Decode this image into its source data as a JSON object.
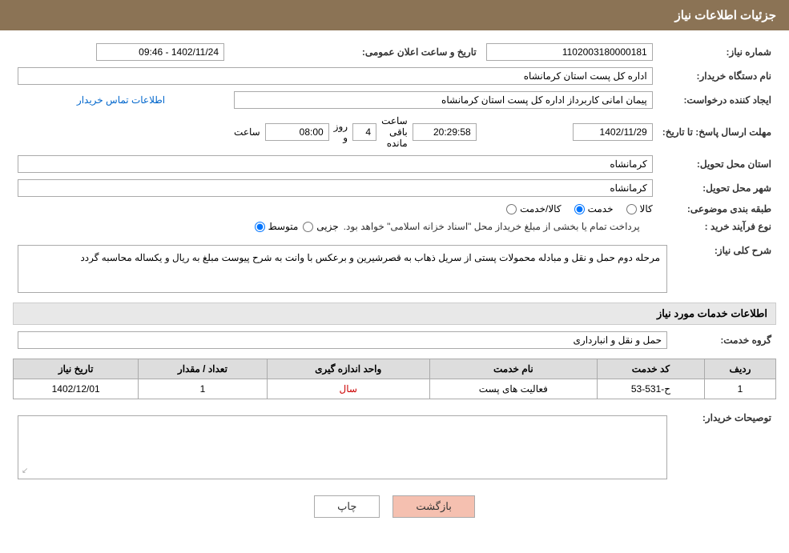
{
  "header": {
    "title": "جزئیات اطلاعات نیاز"
  },
  "fields": {
    "order_number_label": "شماره نیاز:",
    "order_number_value": "1102003180000181",
    "buyer_org_label": "نام دستگاه خریدار:",
    "buyer_org_value": "اداره کل پست استان کرمانشاه",
    "public_announce_label": "تاریخ و ساعت اعلان عمومی:",
    "public_announce_value": "1402/11/24 - 09:46",
    "creator_label": "ایجاد کننده درخواست:",
    "creator_value": "پیمان امانی کاربرداز اداره کل پست استان کرمانشاه",
    "contact_info_link": "اطلاعات تماس خریدار",
    "deadline_label": "مهلت ارسال پاسخ: تا تاریخ:",
    "deadline_date": "1402/11/29",
    "deadline_time_label": "ساعت",
    "deadline_time": "08:00",
    "deadline_days_label": "روز و",
    "deadline_days": "4",
    "deadline_remaining_label": "ساعت باقی مانده",
    "deadline_remaining": "20:29:58",
    "province_label": "استان محل تحویل:",
    "province_value": "کرمانشاه",
    "city_label": "شهر محل تحویل:",
    "city_value": "کرمانشاه",
    "category_label": "طبقه بندی موضوعی:",
    "category_kala": "کالا",
    "category_khedmat": "خدمت",
    "category_kala_khedmat": "کالا/خدمت",
    "category_selected": "khedmat",
    "purchase_type_label": "نوع فرآیند خرید :",
    "purchase_type_jozi": "جزیی",
    "purchase_type_motevaset": "متوسط",
    "purchase_type_note": "پرداخت تمام یا بخشی از مبلغ خریداز محل \"اسناد خزانه اسلامی\" خواهد بود.",
    "purchase_type_selected": "motevaset"
  },
  "description": {
    "label": "شرح کلی نیاز:",
    "text": "مرحله دوم حمل و نقل و مبادله محمولات پستی  از سریل ذهاب به قصرشیرین و برعکس با وانت به شرح پیوست مبلغ به ریال  و یکساله محاسبه گردد"
  },
  "services_info": {
    "header": "اطلاعات خدمات مورد نیاز",
    "service_group_label": "گروه خدمت:",
    "service_group_value": "حمل و نقل و انبارداری",
    "table_headers": [
      "ردیف",
      "کد خدمت",
      "نام خدمت",
      "واحد اندازه گیری",
      "تعداد / مقدار",
      "تاریخ نیاز"
    ],
    "table_rows": [
      {
        "row": "1",
        "code": "ح-531-53",
        "name": "فعالیت های پست",
        "unit": "سال",
        "count": "1",
        "date": "1402/12/01"
      }
    ]
  },
  "buyer_notes": {
    "label": "توصیحات خریدار:",
    "text": ""
  },
  "buttons": {
    "back_label": "بازگشت",
    "print_label": "چاپ"
  }
}
